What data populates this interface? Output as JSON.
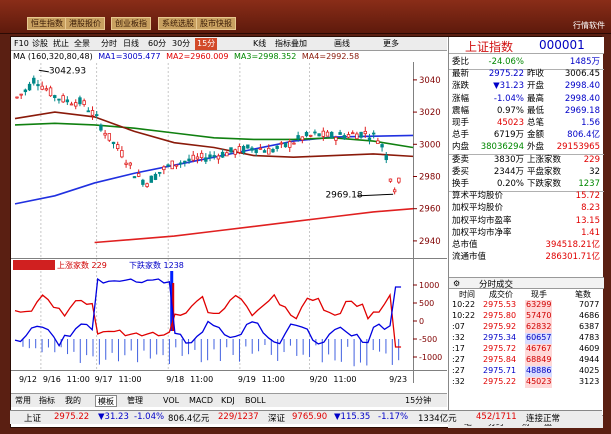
{
  "top_bar": {
    "buttons": [
      "恒生指数",
      "港股报价",
      "创业板指",
      "系统选股",
      "股市快报"
    ],
    "right_text": "行情软件"
  },
  "toolbar": {
    "items": [
      "F10",
      "诊股",
      "扰止",
      "全景",
      "分时",
      "日线",
      "60分",
      "30分",
      "15分",
      "K线",
      "指标叠加",
      "画线",
      "更多"
    ],
    "active": "15分"
  },
  "ma_legend": {
    "params": "MA (160,320,80,48)",
    "ma1": "MA1=3005.477",
    "ma2": "MA2=2960.009",
    "ma3": "MA3=2998.352",
    "ma4": "MA4=2992.58"
  },
  "chart_data": {
    "type": "candlestick",
    "price_axis": {
      "ylim": [
        2930,
        3048
      ],
      "ticks": [
        "3040",
        "3020",
        "3000",
        "2980",
        "2960",
        "2940"
      ]
    },
    "volume_axis": {
      "ticks": [
        "1000",
        "500",
        "0",
        "-500",
        "-1000"
      ]
    },
    "date_labels": [
      "9/12",
      "9/16",
      "11:00",
      "9/17",
      "11:00",
      "9/18",
      "11:00",
      "9/19",
      "11:00",
      "9/20",
      "11:00",
      "9/23"
    ],
    "annotations": {
      "high": "3042.93",
      "low": "2969.18"
    },
    "ma_series": [
      {
        "name": "MA1",
        "color": "#2030e0",
        "points": [
          [
            0,
            2963
          ],
          [
            0.1,
            2968
          ],
          [
            0.2,
            2976
          ],
          [
            0.3,
            2982
          ],
          [
            0.4,
            2987
          ],
          [
            0.5,
            2992
          ],
          [
            0.6,
            2997
          ],
          [
            0.7,
            3002
          ],
          [
            0.8,
            3004.5
          ],
          [
            0.9,
            3005
          ],
          [
            1,
            3005.5
          ]
        ]
      },
      {
        "name": "MA2",
        "color": "#e02020",
        "points": [
          [
            0.2,
            2939
          ],
          [
            0.3,
            2941
          ],
          [
            0.4,
            2943
          ],
          [
            0.5,
            2946
          ],
          [
            0.6,
            2949
          ],
          [
            0.7,
            2952
          ],
          [
            0.8,
            2955
          ],
          [
            0.9,
            2958
          ],
          [
            1,
            2960
          ]
        ]
      },
      {
        "name": "MA3",
        "color": "#108010",
        "points": [
          [
            0,
            3012
          ],
          [
            0.1,
            3013
          ],
          [
            0.2,
            3012
          ],
          [
            0.3,
            3010
          ],
          [
            0.4,
            3007
          ],
          [
            0.5,
            3004
          ],
          [
            0.6,
            3003
          ],
          [
            0.7,
            3003
          ],
          [
            0.8,
            3004
          ],
          [
            0.9,
            3002
          ],
          [
            1,
            2998
          ]
        ]
      },
      {
        "name": "MA4",
        "color": "#8a1a0a",
        "points": [
          [
            0,
            3016
          ],
          [
            0.1,
            3020
          ],
          [
            0.2,
            3017
          ],
          [
            0.3,
            3008
          ],
          [
            0.4,
            3001
          ],
          [
            0.5,
            2998
          ],
          [
            0.6,
            2993
          ],
          [
            0.7,
            2992
          ],
          [
            0.8,
            2993
          ],
          [
            0.9,
            2994
          ],
          [
            1,
            2992.5
          ]
        ]
      }
    ]
  },
  "panel": {
    "name": "上证指数",
    "code": "000001",
    "rows": [
      {
        "l1": "委比",
        "v1": "-24.06%",
        "c1": "green",
        "l2": "",
        "v2": "1485万",
        "c2": "blue"
      },
      {
        "l1": "最新",
        "v1": "2975.22",
        "c1": "blue",
        "l2": "昨收",
        "v2": "3006.45",
        "c2": "black"
      },
      {
        "l1": "涨跌",
        "v1": "▼31.23",
        "c1": "blue",
        "l2": "开盘",
        "v2": "2998.40",
        "c2": "blue"
      },
      {
        "l1": "涨幅",
        "v1": "-1.04%",
        "c1": "blue",
        "l2": "最高",
        "v2": "2998.40",
        "c2": "blue"
      },
      {
        "l1": "震幅",
        "v1": "0.97%",
        "c1": "black",
        "l2": "最低",
        "v2": "2969.18",
        "c2": "blue"
      },
      {
        "l1": "现手",
        "v1": "45023",
        "c1": "red",
        "l2": "总笔",
        "v2": "1.56",
        "c2": "blue"
      },
      {
        "l1": "总手",
        "v1": "6719万",
        "c1": "black",
        "l2": "金额",
        "v2": "806.4亿",
        "c2": "blue"
      },
      {
        "l1": "内盘",
        "v1": "38036294",
        "c1": "green",
        "l2": "外盘",
        "v2": "29153965",
        "c2": "red"
      },
      {
        "l1": "委卖",
        "v1": "3830万",
        "c1": "black",
        "l2": "上涨家数",
        "v2": "229",
        "c2": "red"
      },
      {
        "l1": "委买",
        "v1": "2344万",
        "c1": "black",
        "l2": "平盘家数",
        "v2": "32",
        "c2": "black"
      },
      {
        "l1": "换手",
        "v1": "0.20%",
        "c1": "black",
        "l2": "下跌家数",
        "v2": "1237",
        "c2": "green"
      },
      {
        "l1": "算术平均股价",
        "v1": "",
        "c1": "black",
        "l2": "",
        "v2": "15.72",
        "c2": "red"
      },
      {
        "l1": "加权平均股价",
        "v1": "",
        "c1": "black",
        "l2": "",
        "v2": "8.23",
        "c2": "red"
      },
      {
        "l1": "加权平均市盈率",
        "v1": "",
        "c1": "black",
        "l2": "",
        "v2": "13.15",
        "c2": "red"
      },
      {
        "l1": "加权平均市净率",
        "v1": "",
        "c1": "black",
        "l2": "",
        "v2": "1.41",
        "c2": "red"
      },
      {
        "l1": "总市值",
        "v1": "",
        "c1": "black",
        "l2": "",
        "v2": "394518.21亿",
        "c2": "red"
      },
      {
        "l1": "流通市值",
        "v1": "",
        "c1": "black",
        "l2": "",
        "v2": "286301.71亿",
        "c2": "red"
      }
    ],
    "trades_title": "分时成交",
    "trade_cols": [
      "时间",
      "成交价",
      "现手",
      "笔数"
    ],
    "trades": [
      {
        "time": "10:22",
        "price": "2975.53",
        "vol": "63299",
        "n": "7077",
        "dir": "red"
      },
      {
        "time": "10:22",
        "price": "2975.80",
        "vol": "57470",
        "n": "4686",
        "dir": "red"
      },
      {
        "time": ":07",
        "price": "2975.92",
        "vol": "62832",
        "n": "6387",
        "dir": "red"
      },
      {
        "time": ":32",
        "price": "2975.34",
        "vol": "60657",
        "n": "4783",
        "dir": "blue"
      },
      {
        "time": ":17",
        "price": "2975.72",
        "vol": "46767",
        "n": "4609",
        "dir": "red"
      },
      {
        "time": ":27",
        "price": "2975.84",
        "vol": "68849",
        "n": "4944",
        "dir": "red"
      },
      {
        "time": ":27",
        "price": "2975.71",
        "vol": "48886",
        "n": "4025",
        "dir": "blue"
      },
      {
        "time": ":32",
        "price": "2975.22",
        "vol": "45023",
        "n": "3123",
        "dir": "red"
      }
    ],
    "tabs": [
      "笔",
      "分时",
      "财",
      "盘"
    ]
  },
  "chart_bottom": {
    "items": [
      "常用",
      "指标",
      "我的",
      "模板",
      "管理",
      "VOL",
      "MACD",
      "KDJ",
      "BOLL"
    ],
    "active": "模板",
    "period": "15分钟"
  },
  "status_bar": {
    "label": "上证",
    "price": "2975.22",
    "chg": "▼31.23",
    "pct": "-1.04%",
    "amt": "806.4亿元",
    "adv": "229/1237",
    "mkt2": "深证",
    "price2": "9765.90",
    "chg2": "▼115.35",
    "pct2": "-1.17%",
    "amt2": "1334亿元",
    "ratio": "452/1711",
    "conn": "连接正常"
  }
}
